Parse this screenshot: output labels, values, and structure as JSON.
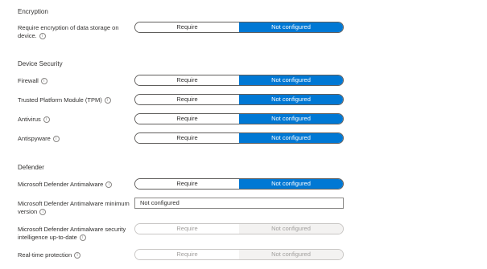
{
  "encryption": {
    "section_title": "Encryption",
    "require_encryption": {
      "label": "Require encryption of data storage on device.",
      "info_icon": "i",
      "option_require": "Require",
      "option_not_configured": "Not configured",
      "selected": "Not configured"
    }
  },
  "device_security": {
    "section_title": "Device Security",
    "firewall": {
      "label": "Firewall",
      "info_icon": "i",
      "option_require": "Require",
      "option_not_configured": "Not configured",
      "selected": "Not configured"
    },
    "tpm": {
      "label": "Trusted Platform Module (TPM)",
      "info_icon": "i",
      "option_require": "Require",
      "option_not_configured": "Not configured",
      "selected": "Not configured"
    },
    "antivirus": {
      "label": "Antivirus",
      "info_icon": "i",
      "option_require": "Require",
      "option_not_configured": "Not configured",
      "selected": "Not configured"
    },
    "antispyware": {
      "label": "Antispyware",
      "info_icon": "i",
      "option_require": "Require",
      "option_not_configured": "Not configured",
      "selected": "Not configured"
    }
  },
  "defender": {
    "section_title": "Defender",
    "antimalware": {
      "label": "Microsoft Defender Antimalware",
      "info_icon": "i",
      "option_require": "Require",
      "option_not_configured": "Not configured",
      "selected": "Not configured"
    },
    "min_version": {
      "label": "Microsoft Defender Antimalware minimum version",
      "info_icon": "i",
      "value": "Not configured"
    },
    "intelligence_up_to_date": {
      "label": "Microsoft Defender Antimalware security intelligence up-to-date",
      "info_icon": "i",
      "option_require": "Require",
      "option_not_configured": "Not configured",
      "selected": "Not configured",
      "disabled": true
    },
    "realtime_protection": {
      "label": "Real-time protection",
      "info_icon": "i",
      "option_require": "Require",
      "option_not_configured": "Not configured",
      "selected": "Not configured",
      "disabled": true
    }
  },
  "colors": {
    "accent": "#0078d4",
    "disabled_fill": "#f3f2f1",
    "text": "#323130"
  }
}
